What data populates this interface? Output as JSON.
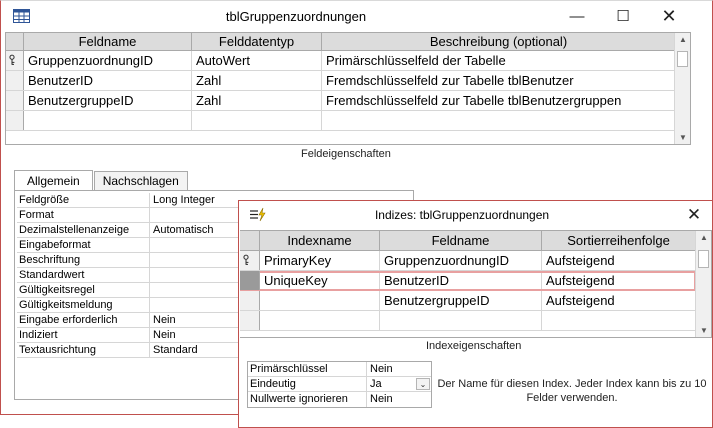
{
  "main_window": {
    "title": "tblGruppenzuordnungen",
    "controls": {
      "minimize": "—",
      "maximize": "☐",
      "close": "✕"
    }
  },
  "design_grid": {
    "headers": [
      "Feldname",
      "Felddatentyp",
      "Beschreibung (optional)"
    ],
    "rows": [
      {
        "field": "GruppenzuordnungID",
        "type": "AutoWert",
        "description": "Primärschlüsselfeld der Tabelle",
        "primary_key": true
      },
      {
        "field": "BenutzerID",
        "type": "Zahl",
        "description": "Fremdschlüsselfeld zur Tabelle tblBenutzer",
        "primary_key": false
      },
      {
        "field": "BenutzergruppeID",
        "type": "Zahl",
        "description": "Fremdschlüsselfeld zur Tabelle tblBenutzergruppen",
        "primary_key": false
      },
      {
        "field": "",
        "type": "",
        "description": "",
        "primary_key": false
      }
    ]
  },
  "field_properties": {
    "section_label": "Feldeigenschaften",
    "tabs": [
      "Allgemein",
      "Nachschlagen"
    ],
    "active_tab": "Allgemein",
    "rows": [
      {
        "name": "Feldgröße",
        "value": "Long Integer"
      },
      {
        "name": "Format",
        "value": ""
      },
      {
        "name": "Dezimalstellenanzeige",
        "value": "Automatisch"
      },
      {
        "name": "Eingabeformat",
        "value": ""
      },
      {
        "name": "Beschriftung",
        "value": ""
      },
      {
        "name": "Standardwert",
        "value": ""
      },
      {
        "name": "Gültigkeitsregel",
        "value": ""
      },
      {
        "name": "Gültigkeitsmeldung",
        "value": ""
      },
      {
        "name": "Eingabe erforderlich",
        "value": "Nein"
      },
      {
        "name": "Indiziert",
        "value": "Nein"
      },
      {
        "name": "Textausrichtung",
        "value": "Standard"
      }
    ]
  },
  "index_dialog": {
    "title": "Indizes: tblGruppenzuordnungen",
    "close": "✕",
    "headers": [
      "Indexname",
      "Feldname",
      "Sortierreihenfolge"
    ],
    "rows": [
      {
        "index_name": "PrimaryKey",
        "field": "GruppenzuordnungID",
        "sort": "Aufsteigend",
        "primary_key": true,
        "selected": false
      },
      {
        "index_name": "UniqueKey",
        "field": "BenutzerID",
        "sort": "Aufsteigend",
        "primary_key": false,
        "selected": true
      },
      {
        "index_name": "",
        "field": "BenutzergruppeID",
        "sort": "Aufsteigend",
        "primary_key": false,
        "selected": false
      },
      {
        "index_name": "",
        "field": "",
        "sort": "",
        "primary_key": false,
        "selected": false
      }
    ],
    "properties_label": "Indexeigenschaften",
    "properties": [
      {
        "name": "Primärschlüssel",
        "value": "Nein"
      },
      {
        "name": "Eindeutig",
        "value": "Ja"
      },
      {
        "name": "Nullwerte ignorieren",
        "value": "Nein"
      }
    ],
    "help_text": "Der Name für diesen Index. Jeder Index kann bis zu 10 Felder verwenden."
  },
  "colors": {
    "accent_border": "#c0504d",
    "selection_outline": "#e8a0a0",
    "header_bg": "#dcdcdc"
  }
}
